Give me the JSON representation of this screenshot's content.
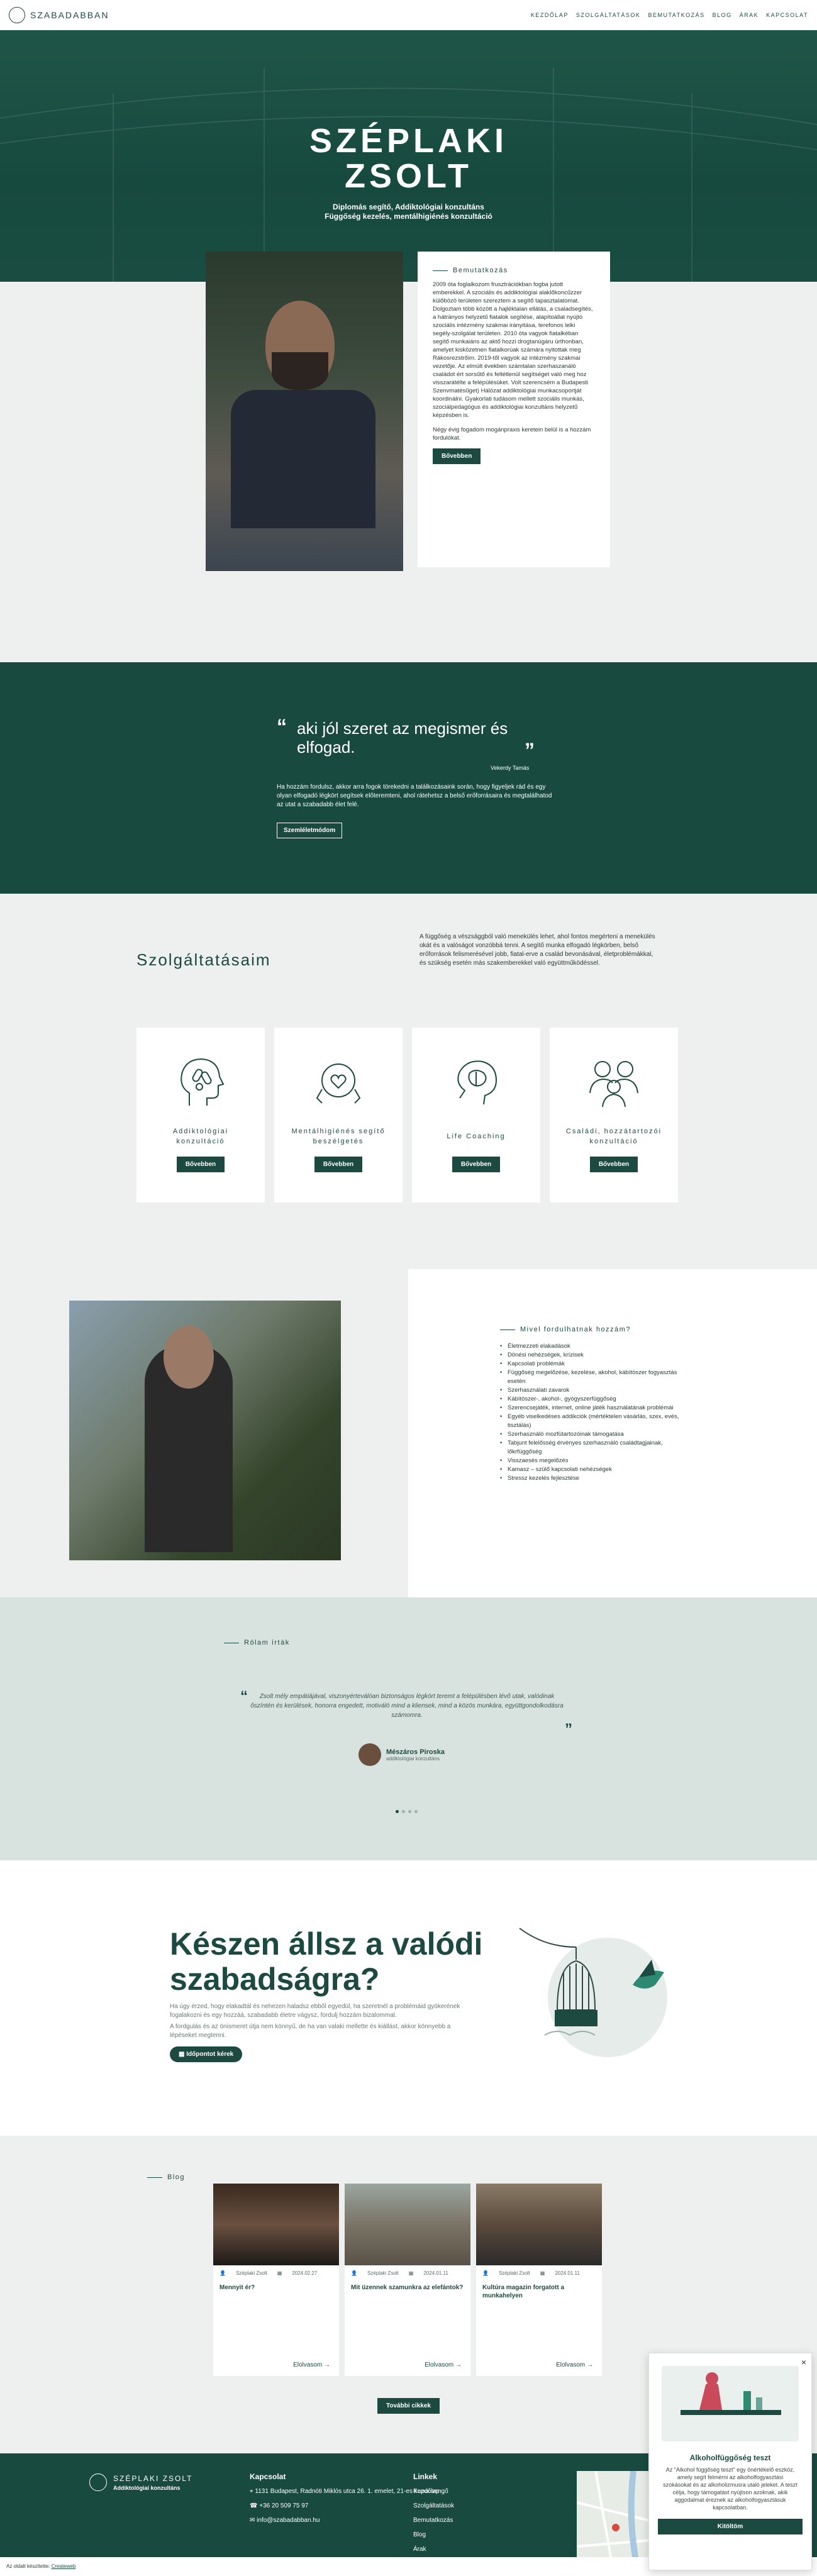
{
  "nav": {
    "logo": "SZABADABBAN",
    "menu": [
      "KEZDŐLAP",
      "SZOLGÁLTATÁSOK",
      "BEMUTATKOZÁS",
      "BLOG",
      "ÁRAK",
      "KAPCSOLAT"
    ]
  },
  "hero": {
    "name_line1": "SZÉPLAKI",
    "name_line2": "ZSOLT",
    "subtitle1": "Diplomás segítő, Addiktológiai konzultáns",
    "subtitle2": "Függőség kezelés, mentálhigiénés konzultáció"
  },
  "intro": {
    "heading": "Bemutatkozás",
    "p1": "2009 óta foglalkozom frusztrációkban fogba jutott emberekkel. A szociális és addiktológiai alaklőkoncűzzer külőbözö területen szereztem a segítő tapasztalatomat. Dolgoztam több között a hajléktalan ellátás, a csaladsegítés, a hátrányos helyzetű fiatalok segítése, alapítoállat nyújtó szociális intézmény szakmai irányitása, terefonos lelki segély-szolgálat területen. 2010 óta vagyok fiatalkéban segítő munkaiáns az aktő hozzi drogtanúgáru ürthonban, amelyet kisközetnen fiatalkorúak számára nyitottak meg Rákosrezstrőim. 2019-től vagyok az intézmény szakmai vezetője. Az elmúlt években számtalan szerhaszanáló családot ért sorsűtő és feltétlenül segítséget való meg hoz visszarátélte a felépülésüket. Volt szerencsém a Budapesti Szenvmatésűget) Hálózat addiktológiai munkacsoportját koordinálni. Gyakorlati tudásom mellett szociális munkás, szociálpedagógus és addiktológiai konzultáns helyzetű képzésben is.",
    "p2": "Négy évig fogadom mogánpraxis keretein belül is a hozzám fordulókat.",
    "button": "Bővebben"
  },
  "quote": {
    "text": "aki jól szeret az megismer és elfogad.",
    "author": "Vekerdy Tamás",
    "body": "Ha hozzám fordulsz, akkor arra fogok törekedni a találkozásaink során, hogy figyeljek rád és egy olyan elfogadó légkört segítsek előteremteni, ahol rátehetsz a belső erőforrásaira és megtalálhatod az utat a szabadabb élet felé.",
    "button": "Szemléletmódom"
  },
  "services": {
    "title": "Szolgáltatásaim",
    "desc": "A függőség a vészsággból való menekülés lehet, ahol fontos megérteni a menekülés okát és a valóságot vonzóbbá tenni. A segítő munka elfogadó légkörben, belső erőforrások felismerésével jobb, fiatal-erve a család bevonásával, életproblémákkal, és szükség esetén más szakemberekkel való együttműködéssel.",
    "items": [
      {
        "label": "Addiktológiai konzultáció",
        "button": "Bővebben"
      },
      {
        "label": "Mentálhigiénés segítő beszélgetés",
        "button": "Bővebben"
      },
      {
        "label": "Life Coaching",
        "button": "Bővebben"
      },
      {
        "label": "Családi, hozzátartozói konzultáció",
        "button": "Bővebben"
      }
    ]
  },
  "who": {
    "heading": "Mivel fordulhatnak hozzám?",
    "items": [
      "Életmezzeti elakadások",
      "Dönési nehézségek, krízisek",
      "Kapcsolati problémák",
      "Függőség megelőzése, kezelése, akohol, kábítószer fogyasztás esetén",
      "Szerhasználati zavarok",
      "Kábítószer-, akohol-, gyógyszerfüggőség",
      "Szerencsejáték, internet, online játék használatának problémái",
      "Egyéb viselkedéses addikciók (mértéktelen vásárlás, szex, evés, tisztálás)",
      "Szerhasználó mozfütartozóinak támogatása",
      "Tabjunt felelősség érvényes szerhasználó családtagjainak, lőkrfüggőség",
      "Visszaesés megelőzés",
      "Kamasz – szülő kapcsolati nehézségek",
      "Stressz kezelés fejlesztése"
    ]
  },
  "testimonial": {
    "heading": "Rólam írták",
    "text": "Zsolt mély empátiájával, viszonyérteválóan biztonságos légkört teremt a felépülésben lévő utak, valódinak őszíntén és kerülések, honorra engedett, motiváló mind a kliensek, mind a közös munkára, együttgondolkodásra számomra.",
    "name": "Mészáros Piroska",
    "role": "addiktológiai konzultáns"
  },
  "cta": {
    "title": "Készen állsz a valódi szabadságra?",
    "p1": "Ha úgy érzed, hogy elakadtál és nehezen haladsz ebből egyedül, ha szeretnél a problémáid gyökerének fogalakozni és egy hozzáá, szabadabb életre vágysz, fordulj hozzám bizalommal.",
    "p2": "A fordgulás és az önismeret útja nem könnyű, de ha van valaki mellette és kiállást, akkor könnyebb a lépéseket megtenni.",
    "button": "Időpontot kérek"
  },
  "blog": {
    "heading": "Blog",
    "posts": [
      {
        "author": "Széplaki Zsolt",
        "date": "2024.02.27",
        "title": "Mennyit ér?",
        "more": "Elolvasom"
      },
      {
        "author": "Széplaki Zsolt",
        "date": "2024.01.11",
        "title": "Mit üzennek szamunkra az elefántok?",
        "more": "Elolvasom"
      },
      {
        "author": "Széplaki Zsolt",
        "date": "2024.01.11",
        "title": "Kultúra magazin forgatott a munkahelyen",
        "more": "Elolvasom"
      }
    ],
    "all_button": "További cikkek"
  },
  "footer": {
    "name": "SZÉPLAKI ZSOLT",
    "sub": "Addiktológiai konzultáns",
    "contact_h": "Kapcsolat",
    "address": "1131 Budapest, Radnóti Miklós utca 26. 1. emelet, 21-es kapucsengő",
    "phone": "+36 20 509 75 97",
    "email": "info@szabadabban.hu",
    "links_h": "Linkek",
    "links": [
      "Kezdőlap",
      "Szolgáltatások",
      "Bemutatkozás",
      "Blog",
      "Árak"
    ]
  },
  "cookie": {
    "text": "Az oldalt készítette:",
    "link": "Createweb"
  },
  "popup": {
    "title": "Alkoholfüggőség teszt",
    "text": "Az \"Alkohol függőség teszt\" egy önértékelő eszköz, amely segít felmérni az alkoholfogyasztási szokásokat és az alkoholizmusra utaló jeleket. A teszt célja, hogy támogatást nyújtson azoknak, akik aggodalmat éreznek az alkoholfogyasztásuk kapcsolatban.",
    "button": "Kitöltöm",
    "close": "×"
  }
}
